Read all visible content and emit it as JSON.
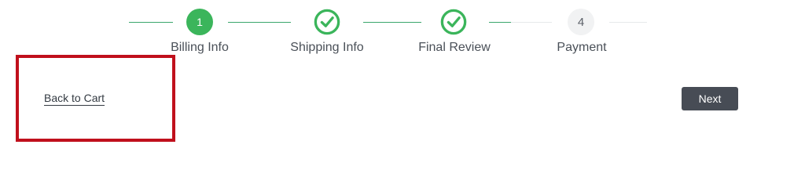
{
  "stepper": {
    "steps": [
      {
        "number": "1",
        "label": "Billing Info",
        "state": "active",
        "icon": ""
      },
      {
        "number": "",
        "label": "Shipping Info",
        "state": "completed",
        "icon": "check-circle-icon"
      },
      {
        "number": "",
        "label": "Final Review",
        "state": "completed",
        "icon": "check-circle-icon"
      },
      {
        "number": "4",
        "label": "Payment",
        "state": "pending",
        "icon": ""
      }
    ]
  },
  "actions": {
    "back_label": "Back to Cart",
    "next_label": "Next"
  },
  "colors": {
    "active": "#3bb55b",
    "completed_line": "#3aa66b",
    "pending_bg": "#f1f2f3",
    "next_button_bg": "#474c55",
    "highlight_border": "#c0101c"
  }
}
